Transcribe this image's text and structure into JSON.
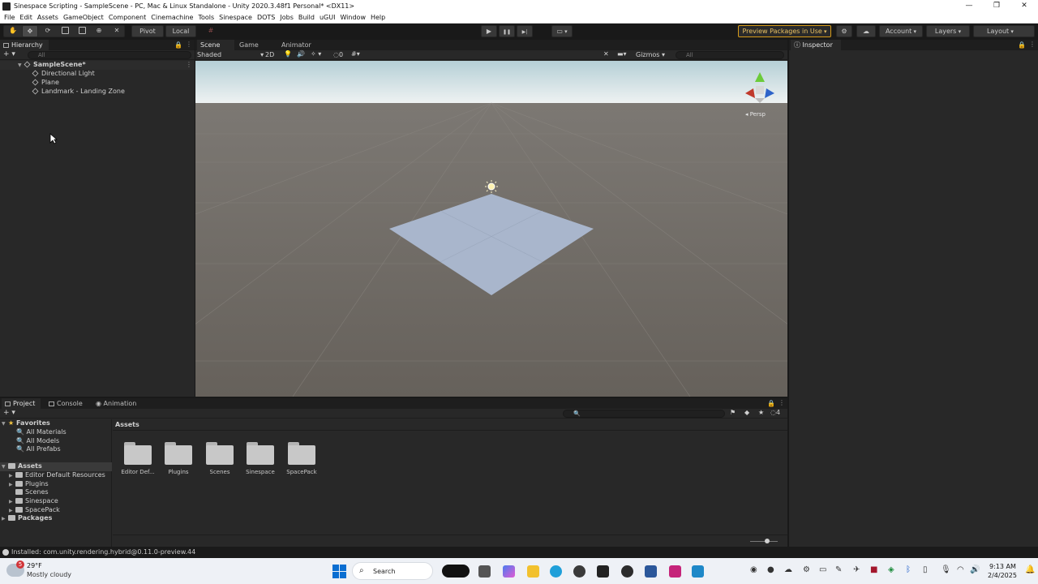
{
  "window": {
    "title": "Sinespace Scripting - SampleScene - PC, Mac & Linux Standalone - Unity 2020.3.48f1 Personal* <DX11>",
    "controls": [
      "—",
      "❐",
      "✕"
    ]
  },
  "menu": [
    "File",
    "Edit",
    "Assets",
    "GameObject",
    "Component",
    "Cinemachine",
    "Tools",
    "Sinespace",
    "DOTS",
    "Jobs",
    "Build",
    "uGUI",
    "Window",
    "Help"
  ],
  "toolbar": {
    "pivot": "Pivot",
    "local": "Local",
    "preview_packages": "Preview Packages in Use",
    "account": "Account",
    "layers": "Layers",
    "layout": "Layout",
    "play_icon": "▶",
    "pause_icon": "❚❚",
    "step_icon": "▶|"
  },
  "hierarchy": {
    "tab": "Hierarchy",
    "add": "+",
    "search_placeholder": "All",
    "scene": "SampleScene*",
    "items": [
      "Directional Light",
      "Plane",
      "Landmark - Landing Zone"
    ]
  },
  "scene_tabs": [
    "Scene",
    "Game",
    "Animator"
  ],
  "scene_toolbar": {
    "shading": "Shaded",
    "mode_2d": "2D",
    "hidden_count": "0",
    "gizmos": "Gizmos",
    "search_placeholder": "All",
    "persp": "Persp"
  },
  "inspector": {
    "tab": "Inspector"
  },
  "bottom_tabs": [
    "Project",
    "Console",
    "Animation"
  ],
  "project": {
    "add": "+",
    "hidden_count": "4",
    "favorites_label": "Favorites",
    "favorites": [
      "All Materials",
      "All Models",
      "All Prefabs"
    ],
    "assets_label": "Assets",
    "assets_tree": [
      "Editor Default Resources",
      "Plugins",
      "Scenes",
      "Sinespace",
      "SpacePack"
    ],
    "packages_label": "Packages",
    "breadcrumb": "Assets",
    "grid": [
      "Editor Def...",
      "Plugins",
      "Scenes",
      "Sinespace",
      "SpacePack"
    ]
  },
  "status": "Installed: com.unity.rendering.hybrid@0.11.0-preview.44",
  "taskbar": {
    "weather_badge": "5",
    "temp": "29°F",
    "condition": "Mostly cloudy",
    "search": "Search",
    "time": "9:13 AM",
    "date": "2/4/2025"
  },
  "colors": {
    "editor_bg": "#282828",
    "accent_orange": "#d69b1a",
    "gizmo_y": "#6ccb3a",
    "gizmo_x": "#c0392b",
    "gizmo_z": "#2e63c9",
    "plane": "#a9b6cc"
  }
}
